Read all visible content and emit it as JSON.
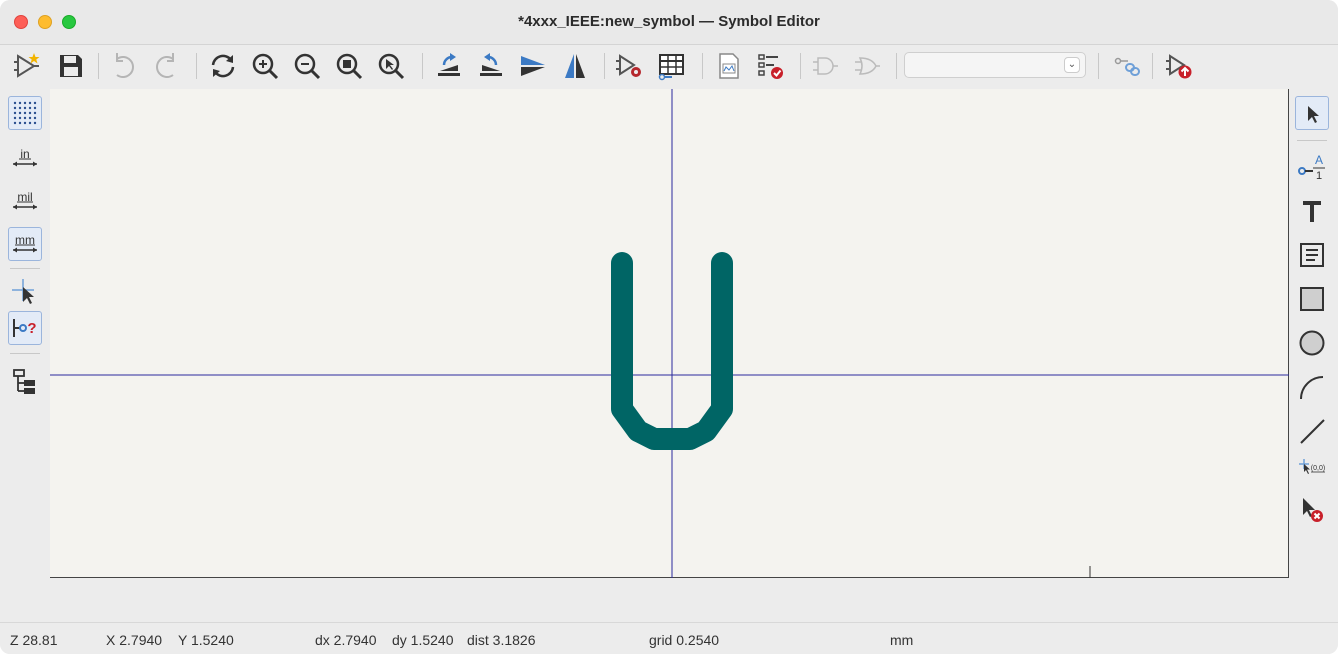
{
  "window": {
    "title": "*4xxx_IEEE:new_symbol — Symbol Editor"
  },
  "toolbar": {
    "buttons": [
      {
        "name": "new-symbol-icon"
      },
      {
        "name": "save-icon"
      },
      {
        "name": "undo-icon"
      },
      {
        "name": "redo-icon"
      },
      {
        "name": "refresh-icon"
      },
      {
        "name": "zoom-in-icon"
      },
      {
        "name": "zoom-out-icon"
      },
      {
        "name": "zoom-fit-icon"
      },
      {
        "name": "zoom-objects-icon"
      },
      {
        "name": "rotate-ccw-icon"
      },
      {
        "name": "rotate-cw-icon"
      },
      {
        "name": "mirror-vertical-icon"
      },
      {
        "name": "mirror-horizontal-icon"
      },
      {
        "name": "symbol-properties-icon"
      },
      {
        "name": "pin-table-icon"
      },
      {
        "name": "datasheet-icon"
      },
      {
        "name": "symbol-checker-icon"
      },
      {
        "name": "unit-normal-icon"
      },
      {
        "name": "unit-demorgan-icon"
      },
      {
        "name": "pin-link-icon"
      },
      {
        "name": "update-symbol-icon"
      }
    ],
    "unit_select_value": ""
  },
  "left_toolbar": {
    "items": [
      {
        "name": "grid-toggle-icon",
        "active": true
      },
      {
        "name": "units-inch-icon",
        "label": "in",
        "active": false
      },
      {
        "name": "units-mil-icon",
        "label": "mil",
        "active": false
      },
      {
        "name": "units-mm-icon",
        "label": "mm",
        "active": true
      },
      {
        "name": "cursor-crosshair-icon",
        "active": false
      },
      {
        "name": "show-pin-types-icon",
        "active": true
      },
      {
        "name": "hierarchy-icon",
        "active": false
      }
    ]
  },
  "right_toolbar": {
    "items": [
      {
        "name": "select-arrow-icon",
        "active": true
      },
      {
        "name": "add-pin-icon",
        "label_top": "A",
        "label_bottom": "1"
      },
      {
        "name": "add-text-icon"
      },
      {
        "name": "add-textbox-icon"
      },
      {
        "name": "add-rectangle-icon"
      },
      {
        "name": "add-circle-icon"
      },
      {
        "name": "add-arc-icon"
      },
      {
        "name": "add-line-icon"
      },
      {
        "name": "anchor-origin-icon",
        "label": "(0,0)"
      },
      {
        "name": "delete-tool-icon"
      }
    ]
  },
  "canvas": {
    "background": "#f4f3ef",
    "shape_color": "#006565",
    "crosshair_color": "#2a2a9c"
  },
  "status": {
    "zoom": "Z 28.81",
    "x": "X 2.7940",
    "y": "Y 1.5240",
    "dx": "dx 2.7940",
    "dy": "dy 1.5240",
    "dist": "dist 3.1826",
    "grid": "grid 0.2540",
    "units": "mm"
  }
}
